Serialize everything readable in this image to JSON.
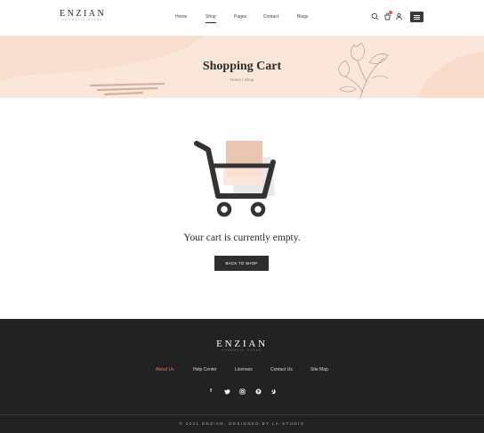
{
  "header": {
    "logo": {
      "main": "ENZIAN",
      "tagline": "COSMETIC STORE"
    },
    "nav": [
      {
        "label": "Home"
      },
      {
        "label": "Shop"
      },
      {
        "label": "Pages"
      },
      {
        "label": "Contact"
      },
      {
        "label": "Blogs"
      }
    ],
    "active_nav": "Shop",
    "icons": [
      "search-icon",
      "cart-icon",
      "user-icon",
      "menu-icon"
    ]
  },
  "banner": {
    "title": "Shopping Cart",
    "breadcrumb": "Home / Shop"
  },
  "main": {
    "empty_message": "Your cart is currently empty.",
    "back_button": "BACK TO SHOP"
  },
  "footer": {
    "logo": {
      "main": "ENZIAN",
      "tagline": "COSMETIC STORE"
    },
    "links": [
      {
        "label": "About Us"
      },
      {
        "label": "Help Center"
      },
      {
        "label": "Licenses"
      },
      {
        "label": "Contact Us"
      },
      {
        "label": "Site Map"
      }
    ],
    "active_link": "About Us",
    "social": [
      "facebook-icon",
      "twitter-icon",
      "instagram-icon",
      "pinterest-icon",
      "dribbble-icon"
    ],
    "copyright": "© 2021 ENZIAN. DESIGNED BY LA-STUDIO"
  },
  "colors": {
    "banner_bg": "#fbe6da",
    "footer_bg": "#222222",
    "accent": "#e07a6a",
    "button_bg": "#2d2d2d",
    "cart_dot": "#e25757"
  }
}
